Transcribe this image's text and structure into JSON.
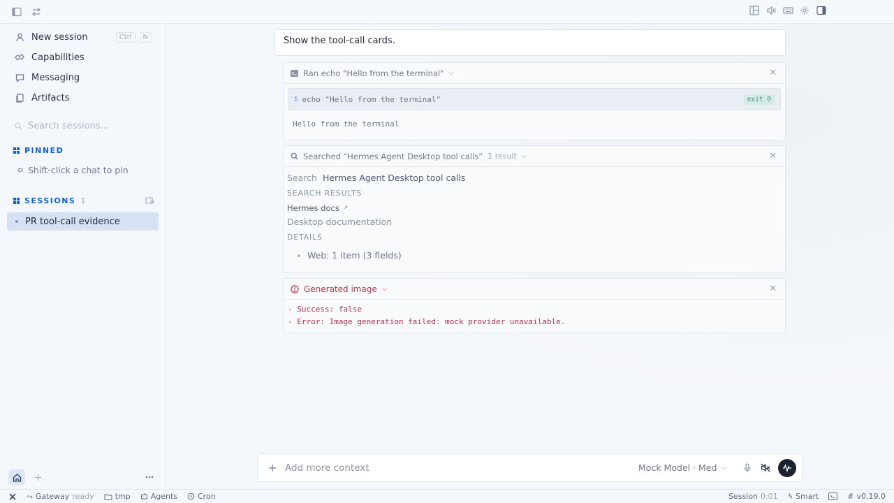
{
  "topbar": {
    "left_icons": [
      "sidebar-toggle-icon",
      "swap-icon"
    ],
    "right_icons": [
      "layout-icon",
      "speaker-icon",
      "keyboard-icon",
      "gear-icon",
      "panel-right-icon"
    ]
  },
  "sidebar": {
    "nav": [
      {
        "label": "New session",
        "icon": "new-session-icon",
        "shortcut": [
          "Ctrl",
          "N"
        ]
      },
      {
        "label": "Capabilities",
        "icon": "capabilities-icon"
      },
      {
        "label": "Messaging",
        "icon": "messaging-icon"
      },
      {
        "label": "Artifacts",
        "icon": "artifacts-icon"
      }
    ],
    "search_placeholder": "Search sessions...",
    "pinned": {
      "title": "PINNED",
      "hint": "Shift-click a chat to pin"
    },
    "sessions": {
      "title": "SESSIONS",
      "count": "1",
      "items": [
        "PR tool-call evidence"
      ]
    }
  },
  "main": {
    "user_message": "Show the tool-call cards.",
    "terminal_card": {
      "title": "Ran echo \"Hello from the terminal\"",
      "command_prefix": "$",
      "command": "echo \"Hello from the terminal\"",
      "exit_badge": "exit 0",
      "output": "Hello from the terminal"
    },
    "search_card": {
      "title": "Searched “Hermes Agent Desktop tool calls”",
      "result_count": "1 result",
      "search_label": "Search",
      "query": "Hermes Agent Desktop tool calls",
      "results_heading": "SEARCH RESULTS",
      "result_title": "Hermes docs",
      "result_desc": "Desktop documentation",
      "details_heading": "DETAILS",
      "detail_item": "Web: 1 item (3 fields)"
    },
    "image_card": {
      "title": "Generated image",
      "lines": [
        "- Success: false",
        "- Error: Image generation failed: mock provider unavailable."
      ]
    }
  },
  "composer": {
    "placeholder": "Add more context",
    "model": "Mock Model · Med"
  },
  "statusbar": {
    "gateway": "Gateway",
    "gateway_status": "ready",
    "folder": "tmp",
    "agents": "Agents",
    "cron": "Cron",
    "session_label": "Session",
    "session_time": "0:01",
    "mode": "Smart",
    "version": "v0.19.0"
  },
  "colors": {
    "accent": "#1260d6",
    "error": "#c0304a",
    "selected": "#d6e2f4",
    "send": "#1b2230"
  }
}
